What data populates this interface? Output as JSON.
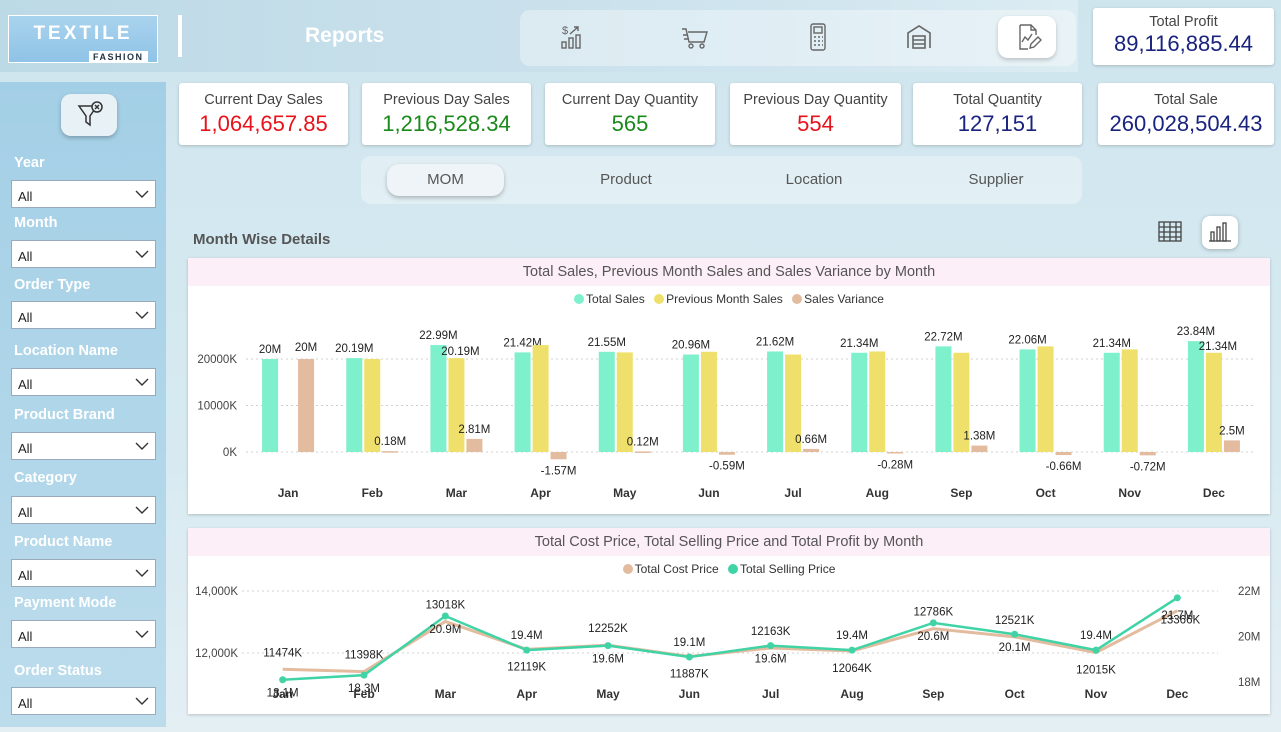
{
  "header": {
    "logo_main": "TEXTILE",
    "logo_sub": "FASHION",
    "page_title": "Reports",
    "nav_icons": [
      "sales-growth-icon",
      "cart-icon",
      "pos-terminal-icon",
      "warehouse-icon",
      "report-edit-icon"
    ],
    "active_nav": 4
  },
  "kpis": {
    "total_profit": {
      "label": "Total Profit",
      "value": "89,116,885.44"
    },
    "current_day_sales": {
      "label": "Current Day Sales",
      "value": "1,064,657.85"
    },
    "previous_day_sales": {
      "label": "Previous Day Sales",
      "value": "1,216,528.34"
    },
    "current_day_quantity": {
      "label": "Current Day Quantity",
      "value": "565"
    },
    "previous_day_quantity": {
      "label": "Previous Day Quantity",
      "value": "554"
    },
    "total_quantity": {
      "label": "Total Quantity",
      "value": "127,151"
    },
    "total_sale": {
      "label": "Total Sale",
      "value": "260,028,504.43"
    }
  },
  "colors": {
    "red": "#e8121a",
    "green": "#1a8a1a",
    "navy": "#1a237e",
    "total_sales": "#7ef0cc",
    "prev_month": "#eee06a",
    "variance": "#e3bb9e",
    "cost": "#e3bb9e",
    "selling": "#3fd3a5"
  },
  "filters": [
    {
      "label": "Year",
      "value": "All"
    },
    {
      "label": "Month",
      "value": "All"
    },
    {
      "label": "Order Type",
      "value": "All"
    },
    {
      "label": "Location Name",
      "value": "All"
    },
    {
      "label": "Product Brand",
      "value": "All"
    },
    {
      "label": "Category",
      "value": "All"
    },
    {
      "label": "Product Name",
      "value": "All"
    },
    {
      "label": "Payment Mode",
      "value": "All"
    },
    {
      "label": "Order Status",
      "value": "All"
    }
  ],
  "tabs": [
    {
      "label": "MOM",
      "active": true
    },
    {
      "label": "Product",
      "active": false
    },
    {
      "label": "Location",
      "active": false
    },
    {
      "label": "Supplier",
      "active": false
    }
  ],
  "section_title": "Month Wise Details",
  "chart_data": [
    {
      "type": "bar",
      "title": "Total Sales, Previous Month Sales and Sales Variance by Month",
      "categories": [
        "Jan",
        "Feb",
        "Mar",
        "Apr",
        "May",
        "Jun",
        "Jul",
        "Aug",
        "Sep",
        "Oct",
        "Nov",
        "Dec"
      ],
      "series": [
        {
          "name": "Total Sales",
          "values": [
            20,
            20.19,
            22.99,
            21.42,
            21.55,
            20.96,
            21.62,
            21.34,
            22.72,
            22.06,
            21.34,
            23.84
          ],
          "labels": [
            "20M",
            "20.19M",
            "22.99M",
            "21.42M",
            "21.55M",
            "20.96M",
            "21.62M",
            "21.34M",
            "22.72M",
            "22.06M",
            "21.34M",
            "23.84M"
          ]
        },
        {
          "name": "Previous Month Sales",
          "values": [
            null,
            20,
            20.19,
            22.99,
            21.42,
            21.55,
            20.96,
            21.62,
            21.34,
            22.72,
            22.06,
            21.34
          ],
          "labels": [
            "",
            "",
            "20.19M",
            "",
            "",
            "",
            "",
            "",
            "",
            "",
            "",
            "21.34M"
          ]
        },
        {
          "name": "Sales Variance",
          "values": [
            20,
            0.18,
            2.81,
            -1.57,
            0.12,
            -0.59,
            0.66,
            -0.28,
            1.38,
            -0.66,
            -0.72,
            2.5
          ],
          "labels": [
            "20M",
            "0.18M",
            "2.81M",
            "-1.57M",
            "0.12M",
            "-0.59M",
            "0.66M",
            "-0.28M",
            "1.38M",
            "-0.66M",
            "-0.72M",
            "2.5M"
          ]
        }
      ],
      "y_ticks": [
        "0K",
        "10000K",
        "20000K"
      ],
      "y_tick_values": [
        0,
        10,
        20
      ],
      "ylim": [
        -2,
        26
      ],
      "legend": "top-center",
      "grid": true
    },
    {
      "type": "line",
      "title": "Total Cost Price, Total Selling Price and Total Profit by Month",
      "categories": [
        "Jan",
        "Feb",
        "Mar",
        "Apr",
        "May",
        "Jun",
        "Jul",
        "Aug",
        "Sep",
        "Oct",
        "Nov",
        "Dec"
      ],
      "series": [
        {
          "name": "Total Cost Price",
          "axis": "left",
          "values": [
            11474,
            11398,
            13018,
            12119,
            12252,
            11887,
            12163,
            12064,
            12786,
            12521,
            12015,
            13366
          ],
          "labels": [
            "11474K",
            "11398K",
            "13018K",
            "12119K",
            "12252K",
            "11887K",
            "12163K",
            "12064K",
            "12786K",
            "12521K",
            "12015K",
            "13366K"
          ]
        },
        {
          "name": "Total Selling Price",
          "axis": "right",
          "values": [
            18.1,
            18.3,
            20.9,
            19.4,
            19.6,
            19.1,
            19.6,
            19.4,
            20.6,
            20.1,
            19.4,
            21.7
          ],
          "labels": [
            "18.1M",
            "18.3M",
            "20.9M",
            "19.4M",
            "19.6M",
            "19.1M",
            "19.6M",
            "19.4M",
            "20.6M",
            "20.1M",
            "19.4M",
            "21.7M"
          ]
        }
      ],
      "y_left_ticks": [
        "12,000K",
        "14,000K"
      ],
      "y_left_tick_values": [
        12000,
        14000
      ],
      "y_right_ticks": [
        "18M",
        "20M",
        "22M"
      ],
      "y_right_tick_values": [
        18,
        20,
        22
      ],
      "legend": "top-center",
      "grid": true
    }
  ]
}
